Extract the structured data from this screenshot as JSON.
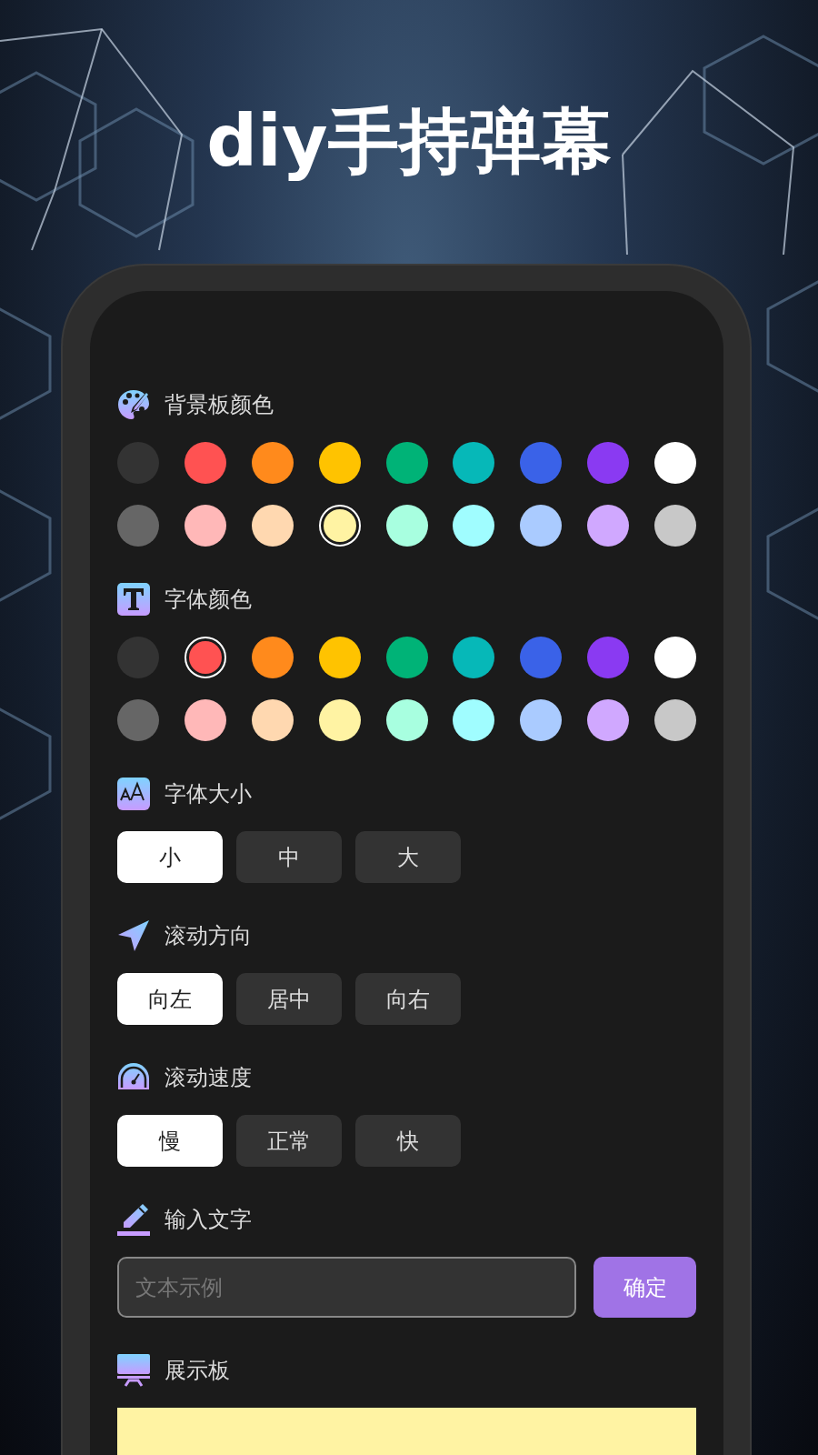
{
  "headline": "diy手持弹幕",
  "sections": [
    {
      "kind": "colors",
      "title": "背景板颜色",
      "colors": [
        {
          "color": "#333333",
          "selected": false
        },
        {
          "color": "#ff5252",
          "selected": false
        },
        {
          "color": "#ff8a1c",
          "selected": false
        },
        {
          "color": "#ffc300",
          "selected": false
        },
        {
          "color": "#00b377",
          "selected": false
        },
        {
          "color": "#06b8b8",
          "selected": false
        },
        {
          "color": "#3a62e8",
          "selected": false
        },
        {
          "color": "#8a3af2",
          "selected": false
        },
        {
          "color": "#ffffff",
          "selected": false
        },
        {
          "color": "#666666",
          "selected": false
        },
        {
          "color": "#ffb8b8",
          "selected": false
        },
        {
          "color": "#ffd8b0",
          "selected": false
        },
        {
          "color": "#fff3a3",
          "selected": true
        },
        {
          "color": "#a8ffe0",
          "selected": false
        },
        {
          "color": "#a0fdff",
          "selected": false
        },
        {
          "color": "#aacbff",
          "selected": false
        },
        {
          "color": "#d0a8ff",
          "selected": false
        },
        {
          "color": "#c8c8c8",
          "selected": false
        }
      ]
    },
    {
      "kind": "colors",
      "title": "字体颜色",
      "colors": [
        {
          "color": "#333333",
          "selected": false
        },
        {
          "color": "#ff5252",
          "selected": true
        },
        {
          "color": "#ff8a1c",
          "selected": false
        },
        {
          "color": "#ffc300",
          "selected": false
        },
        {
          "color": "#00b377",
          "selected": false
        },
        {
          "color": "#06b8b8",
          "selected": false
        },
        {
          "color": "#3a62e8",
          "selected": false
        },
        {
          "color": "#8a3af2",
          "selected": false
        },
        {
          "color": "#ffffff",
          "selected": false
        },
        {
          "color": "#666666",
          "selected": false
        },
        {
          "color": "#ffb8b8",
          "selected": false
        },
        {
          "color": "#ffd8b0",
          "selected": false
        },
        {
          "color": "#fff3a3",
          "selected": false
        },
        {
          "color": "#a8ffe0",
          "selected": false
        },
        {
          "color": "#a0fdff",
          "selected": false
        },
        {
          "color": "#aacbff",
          "selected": false
        },
        {
          "color": "#d0a8ff",
          "selected": false
        },
        {
          "color": "#c8c8c8",
          "selected": false
        }
      ]
    },
    {
      "kind": "options",
      "title": "字体大小",
      "options": [
        {
          "label": "小",
          "selected": true
        },
        {
          "label": "中",
          "selected": false
        },
        {
          "label": "大",
          "selected": false
        }
      ]
    },
    {
      "kind": "options",
      "title": "滚动方向",
      "options": [
        {
          "label": "向左",
          "selected": true
        },
        {
          "label": "居中",
          "selected": false
        },
        {
          "label": "向右",
          "selected": false
        }
      ]
    },
    {
      "kind": "options",
      "title": "滚动速度",
      "options": [
        {
          "label": "慢",
          "selected": true
        },
        {
          "label": "正常",
          "selected": false
        },
        {
          "label": "快",
          "selected": false
        }
      ]
    },
    {
      "kind": "input",
      "title": "输入文字",
      "placeholder": "文本示例",
      "button": "确定"
    },
    {
      "kind": "board",
      "title": "展示板"
    }
  ]
}
